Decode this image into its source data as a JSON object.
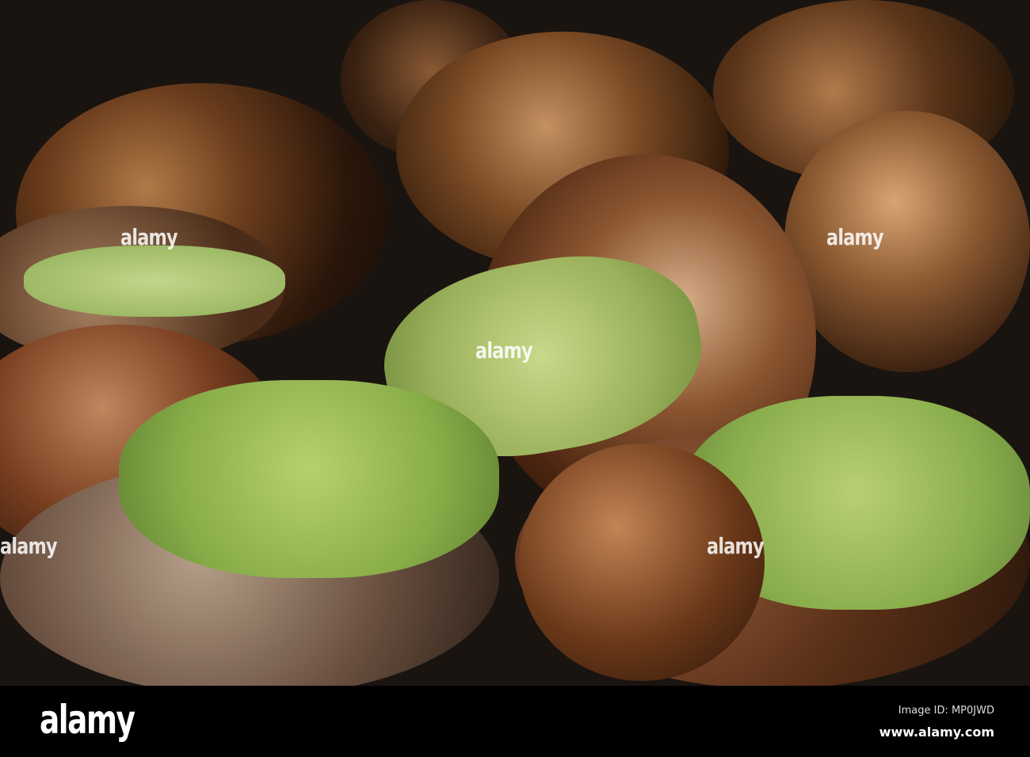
{
  "watermark": "alamy",
  "footer": {
    "logo": "alamy",
    "image_id": "Image ID: MP0JWD",
    "website": "www.alamy.com"
  }
}
